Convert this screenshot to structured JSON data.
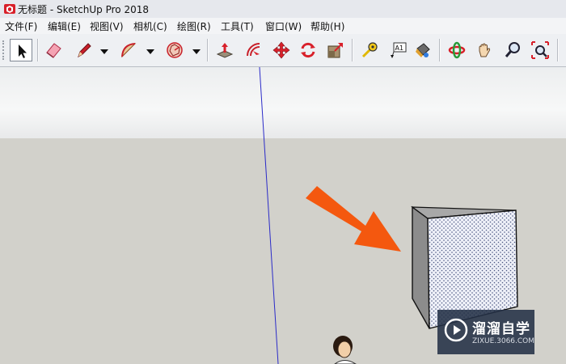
{
  "window": {
    "title": "无标题 - SketchUp Pro 2018",
    "icon": "sketchup-logo-icon"
  },
  "menu": [
    {
      "label": "文件(F)"
    },
    {
      "label": "编辑(E)"
    },
    {
      "label": "视图(V)"
    },
    {
      "label": "相机(C)"
    },
    {
      "label": "绘图(R)"
    },
    {
      "label": "工具(T)"
    },
    {
      "label": "窗口(W)"
    },
    {
      "label": "帮助(H)"
    }
  ],
  "toolbar": {
    "tools": [
      {
        "name": "select",
        "icon": "arrow-cursor-icon",
        "active": true
      },
      {
        "name": "eraser",
        "icon": "eraser-icon"
      },
      {
        "name": "line",
        "icon": "pencil-icon",
        "has_dropdown": true
      },
      {
        "name": "arc",
        "icon": "arc-icon",
        "has_dropdown": true
      },
      {
        "name": "shapes",
        "icon": "polygon-icon",
        "has_dropdown": true
      },
      {
        "name": "push-pull",
        "icon": "push-pull-icon"
      },
      {
        "name": "offset",
        "icon": "offset-icon"
      },
      {
        "name": "move",
        "icon": "move-icon"
      },
      {
        "name": "rotate",
        "icon": "rotate-icon"
      },
      {
        "name": "scale",
        "icon": "scale-icon"
      },
      {
        "name": "tape-measure",
        "icon": "tape-measure-icon"
      },
      {
        "name": "text",
        "icon": "text-label-icon",
        "label": "A1"
      },
      {
        "name": "paint-bucket",
        "icon": "paint-bucket-icon"
      },
      {
        "name": "orbit",
        "icon": "orbit-icon"
      },
      {
        "name": "pan",
        "icon": "hand-icon"
      },
      {
        "name": "zoom",
        "icon": "magnifier-icon"
      },
      {
        "name": "zoom-extents",
        "icon": "zoom-extents-icon"
      }
    ]
  },
  "canvas": {
    "sky_color": "#eeeff0",
    "ground_color": "#d2d1cb",
    "axis_color": "#2b2bc8",
    "arrow_color": "#f4580f",
    "objects": [
      "green-axis-line",
      "box-3d",
      "person-figure"
    ]
  },
  "watermark": {
    "main_text": "溜溜自学",
    "sub_text": "ZIXUE.3066.COM"
  }
}
